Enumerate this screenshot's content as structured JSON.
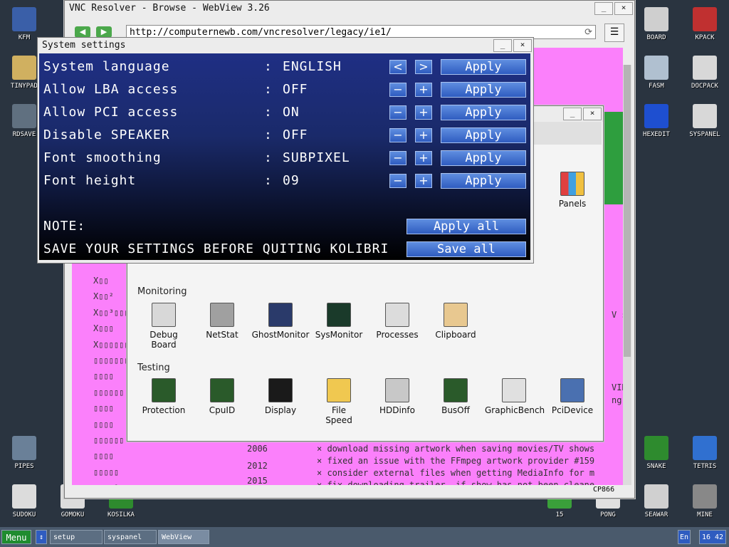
{
  "desktop": {
    "left_icons": [
      {
        "label": "KFM",
        "icon": "floppy-icon",
        "color": "#3a5fa8"
      },
      {
        "label": "TINYPAD",
        "icon": "notepad-icon",
        "color": "#d0b060"
      },
      {
        "label": "RDSAVE",
        "icon": "ramdisk-icon",
        "color": "#607080"
      },
      {
        "label": "PIPES",
        "icon": "pipes-icon",
        "color": "#6a8098"
      },
      {
        "label": "SUDOKU",
        "icon": "sudoku-icon",
        "color": "#dcdcdc"
      },
      {
        "label": "GOMOKU",
        "icon": "gomoku-icon",
        "color": "#dcdcdc"
      },
      {
        "label": "KOSILKA",
        "icon": "lawnmower-icon",
        "color": "#2e8b2e"
      }
    ],
    "right_icons": [
      {
        "label": "BOARD",
        "icon": "board-icon",
        "color": "#cfcfcf"
      },
      {
        "label": "KPACK",
        "icon": "wrench-icon",
        "color": "#c03030"
      },
      {
        "label": "FASM",
        "icon": "fasm-icon",
        "color": "#b0c0d0"
      },
      {
        "label": "DOCPACK",
        "icon": "docpack-icon",
        "color": "#d8d8d8"
      },
      {
        "label": "HEXEDIT",
        "icon": "hexedit-icon",
        "color": "#1e4fd0"
      },
      {
        "label": "SYSPANEL",
        "icon": "syspanel-icon",
        "color": "#d8d8d8"
      },
      {
        "label": "SNAKE",
        "icon": "snake-icon",
        "color": "#2e8b2e"
      },
      {
        "label": "TETRIS",
        "icon": "tetris-icon",
        "color": "#3070d0"
      },
      {
        "label": "15",
        "icon": "fifteen-icon",
        "color": "#3aa03a"
      },
      {
        "label": "PONG",
        "icon": "pong-icon",
        "color": "#e0e0e0"
      },
      {
        "label": "SEAWAR",
        "icon": "seawar-icon",
        "color": "#d0d0d0"
      },
      {
        "label": "MINE",
        "icon": "mine-icon",
        "color": "#888888"
      }
    ]
  },
  "browser": {
    "title": "VNC Resolver - Browse - WebView 3.26",
    "url": "http://computernewb.com/vncresolver/legacy/ie1/",
    "status": "CP866",
    "years": [
      "2006",
      "2012",
      "2015"
    ],
    "log_lines": [
      "× download missing artwork when saving movies/TV shows",
      "× fixed an issue with the FFmpeg artwork provider #159",
      "× consider external files when getting MediaInfo for m",
      "× fix downloading trailer, if show has not been cleane"
    ],
    "right_fragments": [
      "V s",
      "VID",
      "ng e"
    ]
  },
  "syspanel": {
    "sections": [
      "Monitoring",
      "Testing"
    ],
    "top_icon": "Panels",
    "monitoring": [
      "Debug\nBoard",
      "NetStat",
      "GhostMonitor",
      "SysMonitor",
      "Processes",
      "Clipboard"
    ],
    "testing": [
      "Protection",
      "CpuID",
      "Display",
      "File\nSpeed",
      "HDDinfo",
      "BusOff",
      "GraphicBench",
      "PciDevice"
    ]
  },
  "settings": {
    "title": "System settings",
    "rows": [
      {
        "label": "System language",
        "value": "ENGLISH",
        "minus": "<",
        "plus": ">"
      },
      {
        "label": "Allow LBA access",
        "value": "OFF",
        "minus": "−",
        "plus": "+"
      },
      {
        "label": "Allow PCI access",
        "value": "ON",
        "minus": "−",
        "plus": "+"
      },
      {
        "label": "Disable SPEAKER",
        "value": "OFF",
        "minus": "−",
        "plus": "+"
      },
      {
        "label": "Font smoothing",
        "value": "SUBPIXEL",
        "minus": "−",
        "plus": "+"
      },
      {
        "label": "Font height",
        "value": "09",
        "minus": "−",
        "plus": "+"
      }
    ],
    "colon": ":",
    "apply": "Apply",
    "note": "NOTE:",
    "save_note": "SAVE YOUR SETTINGS BEFORE QUITING KOLIBRI",
    "apply_all": "Apply all",
    "save_all": "Save all"
  },
  "taskbar": {
    "menu": "Menu",
    "tasks": [
      "setup",
      "syspanel",
      "WebView"
    ],
    "lang": "En",
    "clock": "16 42"
  },
  "window_controls": {
    "minimize": "_",
    "close": "×"
  }
}
